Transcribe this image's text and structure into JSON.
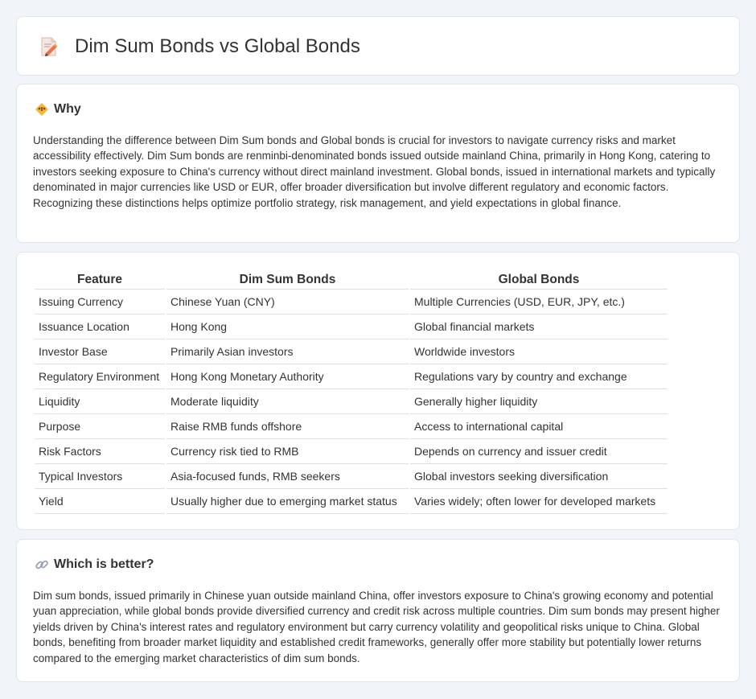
{
  "header": {
    "title": "Dim Sum Bonds vs Global Bonds",
    "icon": "document-pencil-icon"
  },
  "why": {
    "title": "Why",
    "icon": "warning-icon",
    "text": "Understanding the difference between Dim Sum bonds and Global bonds is crucial for investors to navigate currency risks and market accessibility effectively. Dim Sum bonds are renminbi-denominated bonds issued outside mainland China, primarily in Hong Kong, catering to investors seeking exposure to China's currency without direct mainland investment. Global bonds, issued in international markets and typically denominated in major currencies like USD or EUR, offer broader diversification but involve different regulatory and economic factors. Recognizing these distinctions helps optimize portfolio strategy, risk management, and yield expectations in global finance."
  },
  "table": {
    "headers": [
      "Feature",
      "Dim Sum Bonds",
      "Global Bonds"
    ],
    "rows": [
      [
        "Issuing Currency",
        "Chinese Yuan (CNY)",
        "Multiple Currencies (USD, EUR, JPY, etc.)"
      ],
      [
        "Issuance Location",
        "Hong Kong",
        "Global financial markets"
      ],
      [
        "Investor Base",
        "Primarily Asian investors",
        "Worldwide investors"
      ],
      [
        "Regulatory Environment",
        "Hong Kong Monetary Authority",
        "Regulations vary by country and exchange"
      ],
      [
        "Liquidity",
        "Moderate liquidity",
        "Generally higher liquidity"
      ],
      [
        "Purpose",
        "Raise RMB funds offshore",
        "Access to international capital"
      ],
      [
        "Risk Factors",
        "Currency risk tied to RMB",
        "Depends on currency and issuer credit"
      ],
      [
        "Typical Investors",
        "Asia-focused funds, RMB seekers",
        "Global investors seeking diversification"
      ],
      [
        "Yield",
        "Usually higher due to emerging market status",
        "Varies widely; often lower for developed markets"
      ]
    ]
  },
  "better": {
    "title": "Which is better?",
    "icon": "link-icon",
    "text": "Dim sum bonds, issued primarily in Chinese yuan outside mainland China, offer investors exposure to China's growing economy and potential yuan appreciation, while global bonds provide diversified currency and credit risk across multiple countries. Dim sum bonds may present higher yields driven by China's interest rates and regulatory environment but carry currency volatility and geopolitical risks unique to China. Global bonds, benefiting from broader market liquidity and established credit frameworks, generally offer more stability but potentially lower returns compared to the emerging market characteristics of dim sum bonds."
  }
}
